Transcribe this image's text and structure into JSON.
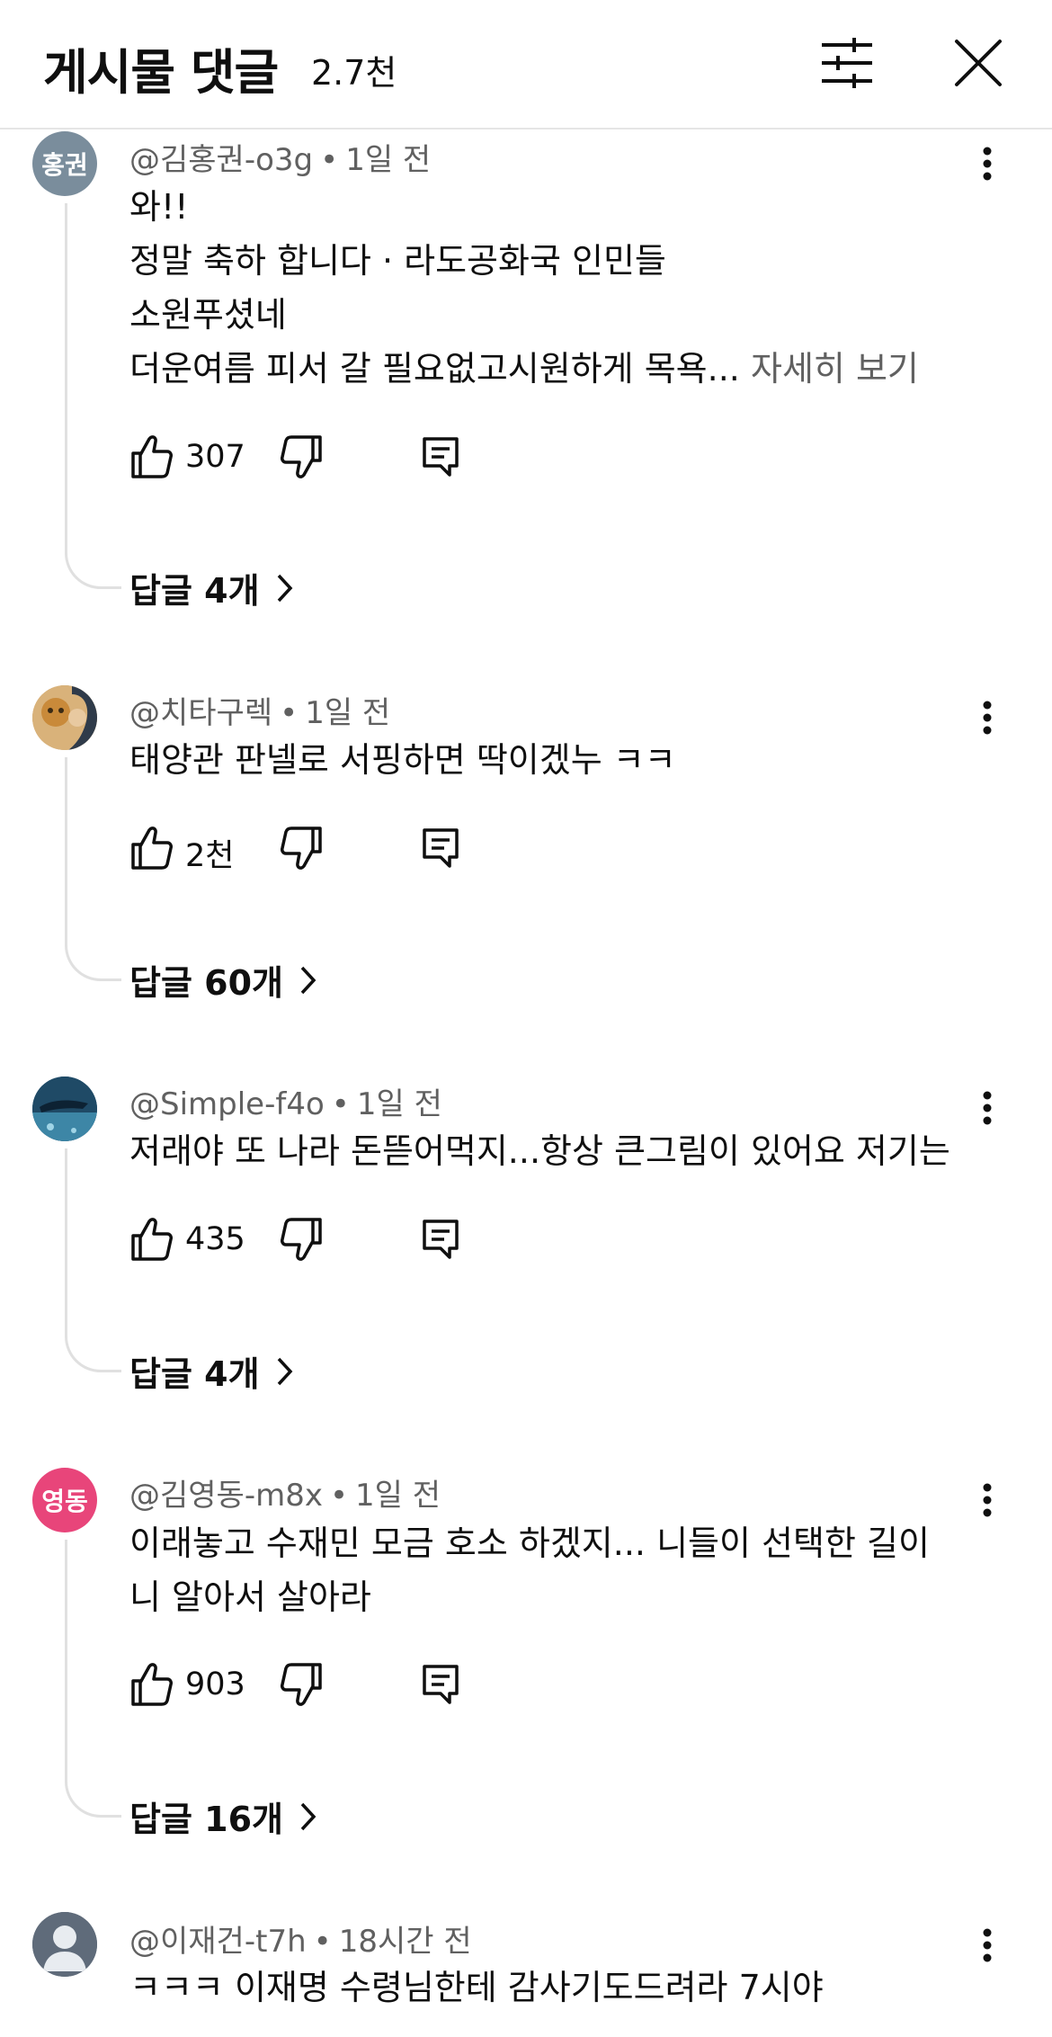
{
  "header": {
    "title": "게시물 댓글",
    "count": "2.7천"
  },
  "comments": [
    {
      "avatar_text": "홍권",
      "avatar_color": "#7a8d9c",
      "author": "@김홍권-o3g",
      "time": "1일 전",
      "lines": [
        "와!!",
        "정말 축하 합니다 · 라도공화국 인민들",
        "소원푸셨네",
        "더운여름  피서 갈 필요없고시원하게 목욕..."
      ],
      "more_label": "자세히 보기",
      "likes": "307",
      "replies_label": "답글 4개"
    },
    {
      "avatar_text": "",
      "avatar_color": "#c9a26a",
      "author": "@치타구렉",
      "time": "1일 전",
      "lines": [
        "태양관 판넬로 서핑하면 딱이겠누 ㅋㅋ"
      ],
      "likes": "2천",
      "replies_label": "답글 60개"
    },
    {
      "avatar_text": "",
      "avatar_color": "#3d6a86",
      "author": "@Simple-f4o",
      "time": "1일 전",
      "lines": [
        "저래야 또 나라 돈뜯어먹지...항상 큰그림이 있어요 저기는"
      ],
      "likes": "435",
      "replies_label": "답글 4개"
    },
    {
      "avatar_text": "영동",
      "avatar_color": "#e8457a",
      "author": "@김영동-m8x",
      "time": "1일 전",
      "lines": [
        "이래놓고 수재민 모금 호소 하겠지... 니들이 선택한 길이",
        "니 알아서 살아라"
      ],
      "likes": "903",
      "replies_label": "답글 16개"
    },
    {
      "avatar_text": "",
      "avatar_color": "#5f6b7a",
      "author": "@이재건-t7h",
      "time": "18시간 전",
      "lines": [
        "ㅋㅋㅋ 이재명 수령님한테 감사기도드려라 7시야"
      ]
    }
  ]
}
